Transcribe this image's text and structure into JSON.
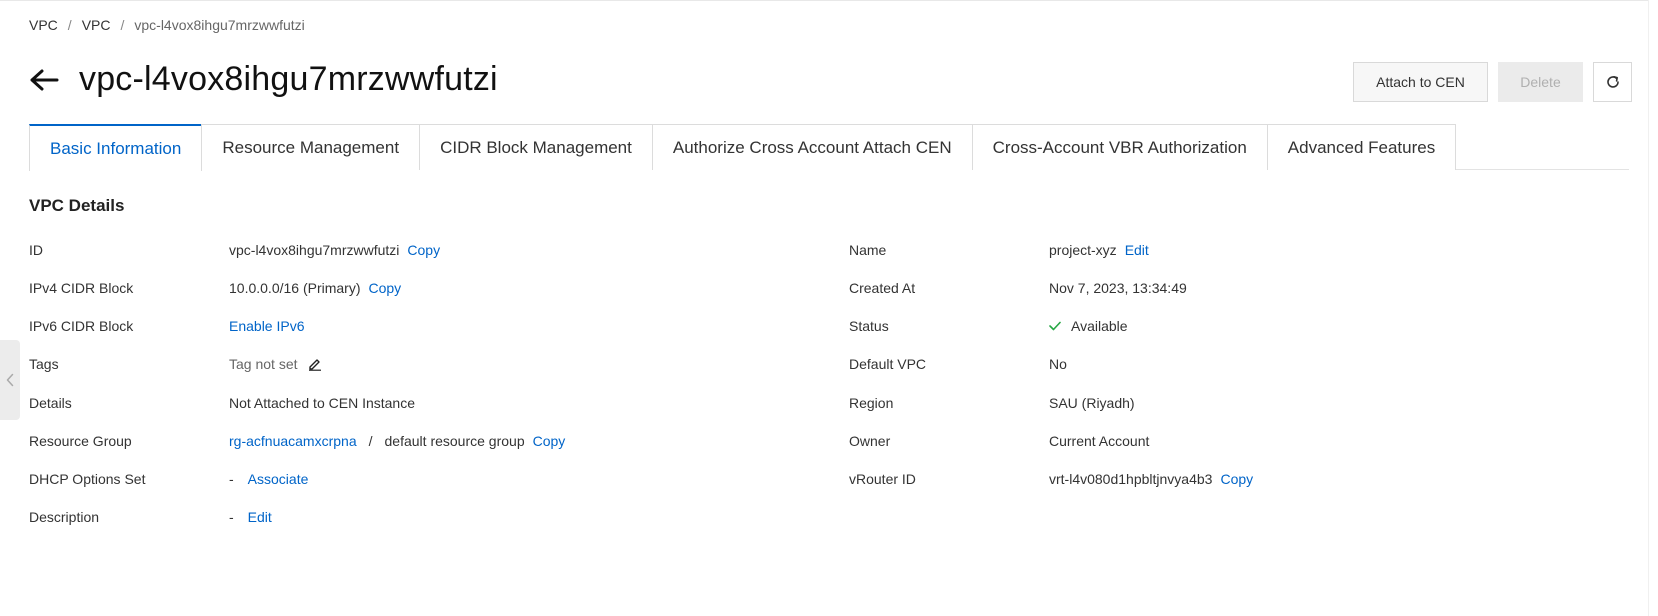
{
  "breadcrumb": {
    "items": [
      "VPC",
      "VPC",
      "vpc-l4vox8ihgu7mrzwwfutzi"
    ],
    "separator": "/"
  },
  "page": {
    "title": "vpc-l4vox8ihgu7mrzwwfutzi"
  },
  "actions": {
    "attach_label": "Attach to CEN",
    "delete_label": "Delete"
  },
  "tabs": [
    {
      "label": "Basic Information",
      "active": true
    },
    {
      "label": "Resource Management"
    },
    {
      "label": "CIDR Block Management"
    },
    {
      "label": "Authorize Cross Account Attach CEN"
    },
    {
      "label": "Cross-Account VBR Authorization"
    },
    {
      "label": "Advanced Features"
    }
  ],
  "section": {
    "title": "VPC Details"
  },
  "details": {
    "left": {
      "id": {
        "label": "ID",
        "value": "vpc-l4vox8ihgu7mrzwwfutzi",
        "action": "Copy"
      },
      "ipv4": {
        "label": "IPv4 CIDR Block",
        "value": "10.0.0.0/16 (Primary)",
        "action": "Copy"
      },
      "ipv6": {
        "label": "IPv6 CIDR Block",
        "action": "Enable IPv6"
      },
      "tags": {
        "label": "Tags",
        "value": "Tag not set"
      },
      "cen": {
        "label": "Details",
        "value": "Not Attached to CEN Instance"
      },
      "resource_group": {
        "label": "Resource Group",
        "link": "rg-acfnuacamxcrpna",
        "separator": "/",
        "value": "default resource group",
        "action": "Copy"
      },
      "dhcp": {
        "label": "DHCP Options Set",
        "value": "-",
        "action": "Associate"
      },
      "description": {
        "label": "Description",
        "value": "-",
        "action": "Edit"
      }
    },
    "right": {
      "name": {
        "label": "Name",
        "value": "project-xyz",
        "action": "Edit"
      },
      "created": {
        "label": "Created At",
        "value": "Nov 7, 2023, 13:34:49"
      },
      "status": {
        "label": "Status",
        "value": "Available",
        "color": "#27a745"
      },
      "default_vpc": {
        "label": "Default VPC",
        "value": "No"
      },
      "region": {
        "label": "Region",
        "value": "SAU (Riyadh)"
      },
      "owner": {
        "label": "Owner",
        "value": "Current Account"
      },
      "vrouter": {
        "label": "vRouter ID",
        "value": "vrt-l4v080d1hpbltjnvya4b3",
        "action": "Copy"
      }
    }
  },
  "colors": {
    "accent": "#0064c8",
    "success": "#27a745"
  }
}
